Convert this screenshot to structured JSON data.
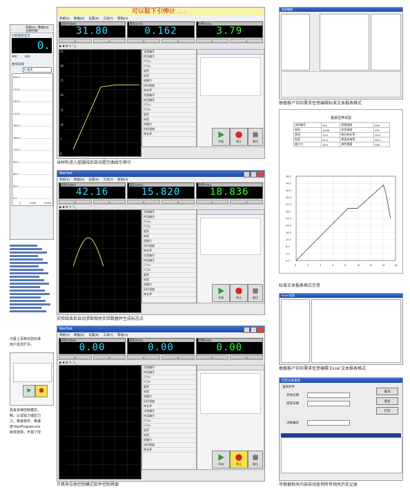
{
  "banner": {
    "title": "可以取下引伸计"
  },
  "app": {
    "menu": [
      "系统(S)",
      "数据(D)",
      "设置(E)",
      "工具(T)",
      "帮助(H)"
    ],
    "ro_labels": [
      "试验力(kN)",
      "变形(mm)",
      "位移(mm)"
    ],
    "tool_labels": [
      "开始",
      "停止",
      "复位"
    ]
  },
  "screen1": {
    "readouts": [
      "31.80",
      "0.162",
      "3.79"
    ],
    "y_ticks": [
      "35",
      "30",
      "25",
      "20",
      "15",
      "10",
      "5",
      "0"
    ],
    "caption": "当材料进入屈服段后自动提示曲线引伸计",
    "params": [
      "试验编号",
      "样品编号",
      "尺寸a",
      "尺寸b",
      "面积",
      "标距",
      "屈服力",
      "抗拉强度",
      "伸长率"
    ]
  },
  "screen2": {
    "readouts": [
      "42.16",
      "15.820",
      "18.836"
    ],
    "caption": "实验结束后自动求取相关实验数据并生成标志点"
  },
  "screen3": {
    "readouts": [
      "0.00",
      "0.00",
      "0.00"
    ],
    "caption": "只具有位移控制模式软件控制界面"
  },
  "left": {
    "top_labels": [
      "系统(S)",
      "数据(D)",
      "设置",
      "位移控制"
    ],
    "force_title": "力和变形显示",
    "force_value": "0.",
    "speed_values": [
      "300",
      "350"
    ],
    "curve_title": "曲线选择",
    "curve_type": "力-变形",
    "y_ticks": [
      "300.0",
      "270.0",
      "240.0",
      "210.0",
      "180.0",
      "150.0",
      "120.0",
      "90.0",
      "60.0",
      "30.0",
      "0.0"
    ],
    "x_ticks": [
      "0",
      "1.500",
      "3.000"
    ],
    "caption1": "内置上百种试验标准",
    "caption1b": "用户需求扩充。",
    "caption2_lines": [
      "具有多种控制模式，",
      "制，以试验力或应力",
      "力、等速变形、等速",
      "用 MaxProgram.exe",
      "就将选择，丰富了控"
    ]
  },
  "right": {
    "caption1": "根据客户实际需求任意编辑标准文本报表格式",
    "caption2": "标准文本报表格式示意",
    "caption3": "根据客户实际需求任意编辑 Excel 文本报表格式",
    "caption4": "可根据相关内容自动查询所有相关历史记录",
    "report_title": "金属拉伸试验",
    "report_rows": [
      [
        "试样编号",
        "001",
        "屈服强度",
        "345"
      ],
      [
        "材料",
        "Q235",
        "抗拉强度",
        "470"
      ],
      [
        "直径",
        "10.0",
        "断后伸长率",
        "26.5"
      ],
      [
        "标距",
        "50.0",
        "断面收缩率",
        "58.0"
      ],
      [
        "最大力",
        "36.9",
        "弹性模量",
        "206"
      ]
    ],
    "report_y": [
      "48.0",
      "44.0",
      "40.0",
      "36.0",
      "32.0",
      "28.0",
      "24.0",
      "20.0",
      "16.0",
      "12.0",
      "8.0",
      "4.0",
      "0.0"
    ],
    "report_x": [
      "0",
      "2",
      "4",
      "6",
      "8",
      "10",
      "12",
      "14",
      "16"
    ],
    "query_title": "历史记录查询",
    "query_labels": [
      "查询条件",
      "开始日期",
      "结束日期",
      "试样编号"
    ],
    "query_buttons": [
      "查询",
      "退出",
      "打印"
    ]
  }
}
